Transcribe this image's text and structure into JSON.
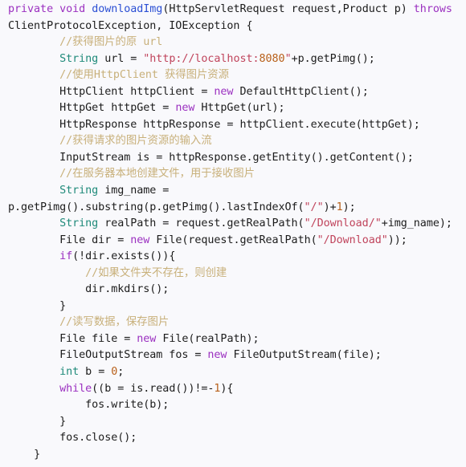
{
  "editor": {
    "name": "java-source-code-view",
    "language": "Java",
    "background_color": "#f9f9fc",
    "colors": {
      "keyword": "#9b30c0",
      "type": "#1f8a7a",
      "method_name": "#2b4fd4",
      "string": "#c0445c",
      "number": "#b8601a",
      "comment": "#c8b07a",
      "plain": "#1c1c1c"
    }
  },
  "code": {
    "lines": [
      {
        "n": 1,
        "indent": 0,
        "tokens": [
          {
            "t": "private",
            "c": "kw"
          },
          {
            "t": " ",
            "c": "pln"
          },
          {
            "t": "void",
            "c": "kw"
          },
          {
            "t": " ",
            "c": "pln"
          },
          {
            "t": "downloadImg",
            "c": "mth"
          },
          {
            "t": "(HttpServletRequest request,Product p) ",
            "c": "pln"
          },
          {
            "t": "throws",
            "c": "kw"
          }
        ]
      },
      {
        "n": 2,
        "indent": 0,
        "tokens": [
          {
            "t": "ClientProtocolException, IOException {",
            "c": "pln"
          }
        ]
      },
      {
        "n": 3,
        "indent": 8,
        "tokens": [
          {
            "t": "//获得图片的原 url",
            "c": "cmt"
          }
        ]
      },
      {
        "n": 4,
        "indent": 8,
        "tokens": [
          {
            "t": "String",
            "c": "typ"
          },
          {
            "t": " url = ",
            "c": "pln"
          },
          {
            "t": "\"http://localhost:",
            "c": "str"
          },
          {
            "t": "8080",
            "c": "num"
          },
          {
            "t": "\"",
            "c": "str"
          },
          {
            "t": "+p.getPimg();",
            "c": "pln"
          }
        ]
      },
      {
        "n": 5,
        "indent": 8,
        "tokens": [
          {
            "t": "//使用HttpClient 获得图片资源",
            "c": "cmt"
          }
        ]
      },
      {
        "n": 6,
        "indent": 8,
        "tokens": [
          {
            "t": "HttpClient httpClient = ",
            "c": "pln"
          },
          {
            "t": "new",
            "c": "kw"
          },
          {
            "t": " DefaultHttpClient();",
            "c": "pln"
          }
        ]
      },
      {
        "n": 7,
        "indent": 8,
        "tokens": [
          {
            "t": "HttpGet httpGet = ",
            "c": "pln"
          },
          {
            "t": "new",
            "c": "kw"
          },
          {
            "t": " HttpGet(url);",
            "c": "pln"
          }
        ]
      },
      {
        "n": 8,
        "indent": 8,
        "tokens": [
          {
            "t": "HttpResponse httpResponse = httpClient.execute(httpGet);",
            "c": "pln"
          }
        ]
      },
      {
        "n": 9,
        "indent": 8,
        "tokens": [
          {
            "t": "//获得请求的图片资源的输入流",
            "c": "cmt"
          }
        ]
      },
      {
        "n": 10,
        "indent": 8,
        "tokens": [
          {
            "t": "InputStream is = httpResponse.getEntity().getContent();",
            "c": "pln"
          }
        ]
      },
      {
        "n": 11,
        "indent": 8,
        "tokens": [
          {
            "t": "//在服务器本地创建文件，用于接收图片",
            "c": "cmt"
          }
        ]
      },
      {
        "n": 12,
        "indent": 8,
        "tokens": [
          {
            "t": "String",
            "c": "typ"
          },
          {
            "t": " img_name =",
            "c": "pln"
          }
        ]
      },
      {
        "n": 13,
        "indent": 0,
        "tokens": [
          {
            "t": "p.getPimg().substring(p.getPimg().lastIndexOf(",
            "c": "pln"
          },
          {
            "t": "\"/\"",
            "c": "str"
          },
          {
            "t": ")+",
            "c": "pln"
          },
          {
            "t": "1",
            "c": "num"
          },
          {
            "t": ");",
            "c": "pln"
          }
        ]
      },
      {
        "n": 14,
        "indent": 8,
        "tokens": [
          {
            "t": "String",
            "c": "typ"
          },
          {
            "t": " realPath = request.getRealPath(",
            "c": "pln"
          },
          {
            "t": "\"/Download/\"",
            "c": "str"
          },
          {
            "t": "+img_name);",
            "c": "pln"
          }
        ]
      },
      {
        "n": 15,
        "indent": 8,
        "tokens": [
          {
            "t": "File dir = ",
            "c": "pln"
          },
          {
            "t": "new",
            "c": "kw"
          },
          {
            "t": " File(request.getRealPath(",
            "c": "pln"
          },
          {
            "t": "\"/Download\"",
            "c": "str"
          },
          {
            "t": "));",
            "c": "pln"
          }
        ]
      },
      {
        "n": 16,
        "indent": 8,
        "tokens": [
          {
            "t": "if",
            "c": "kw"
          },
          {
            "t": "(!dir.exists()){",
            "c": "pln"
          }
        ]
      },
      {
        "n": 17,
        "indent": 12,
        "tokens": [
          {
            "t": "//如果文件夹不存在，则创建",
            "c": "cmt"
          }
        ]
      },
      {
        "n": 18,
        "indent": 12,
        "tokens": [
          {
            "t": "dir.mkdirs();",
            "c": "pln"
          }
        ]
      },
      {
        "n": 19,
        "indent": 8,
        "tokens": [
          {
            "t": "}",
            "c": "pln"
          }
        ]
      },
      {
        "n": 20,
        "indent": 8,
        "tokens": [
          {
            "t": "//读写数据，保存图片",
            "c": "cmt"
          }
        ]
      },
      {
        "n": 21,
        "indent": 8,
        "tokens": [
          {
            "t": "File file = ",
            "c": "pln"
          },
          {
            "t": "new",
            "c": "kw"
          },
          {
            "t": " File(realPath);",
            "c": "pln"
          }
        ]
      },
      {
        "n": 22,
        "indent": 8,
        "tokens": [
          {
            "t": "FileOutputStream fos = ",
            "c": "pln"
          },
          {
            "t": "new",
            "c": "kw"
          },
          {
            "t": " FileOutputStream(file);",
            "c": "pln"
          }
        ]
      },
      {
        "n": 23,
        "indent": 8,
        "tokens": [
          {
            "t": "int",
            "c": "typ"
          },
          {
            "t": " b = ",
            "c": "pln"
          },
          {
            "t": "0",
            "c": "num"
          },
          {
            "t": ";",
            "c": "pln"
          }
        ]
      },
      {
        "n": 24,
        "indent": 8,
        "tokens": [
          {
            "t": "while",
            "c": "kw"
          },
          {
            "t": "((b = is.read())!=-",
            "c": "pln"
          },
          {
            "t": "1",
            "c": "num"
          },
          {
            "t": "){",
            "c": "pln"
          }
        ]
      },
      {
        "n": 25,
        "indent": 12,
        "tokens": [
          {
            "t": "fos.write(b);",
            "c": "pln"
          }
        ]
      },
      {
        "n": 26,
        "indent": 8,
        "tokens": [
          {
            "t": "}",
            "c": "pln"
          }
        ]
      },
      {
        "n": 27,
        "indent": 8,
        "tokens": [
          {
            "t": "fos.close();",
            "c": "pln"
          }
        ]
      },
      {
        "n": 28,
        "indent": 4,
        "tokens": [
          {
            "t": "}",
            "c": "pln"
          }
        ]
      }
    ]
  }
}
